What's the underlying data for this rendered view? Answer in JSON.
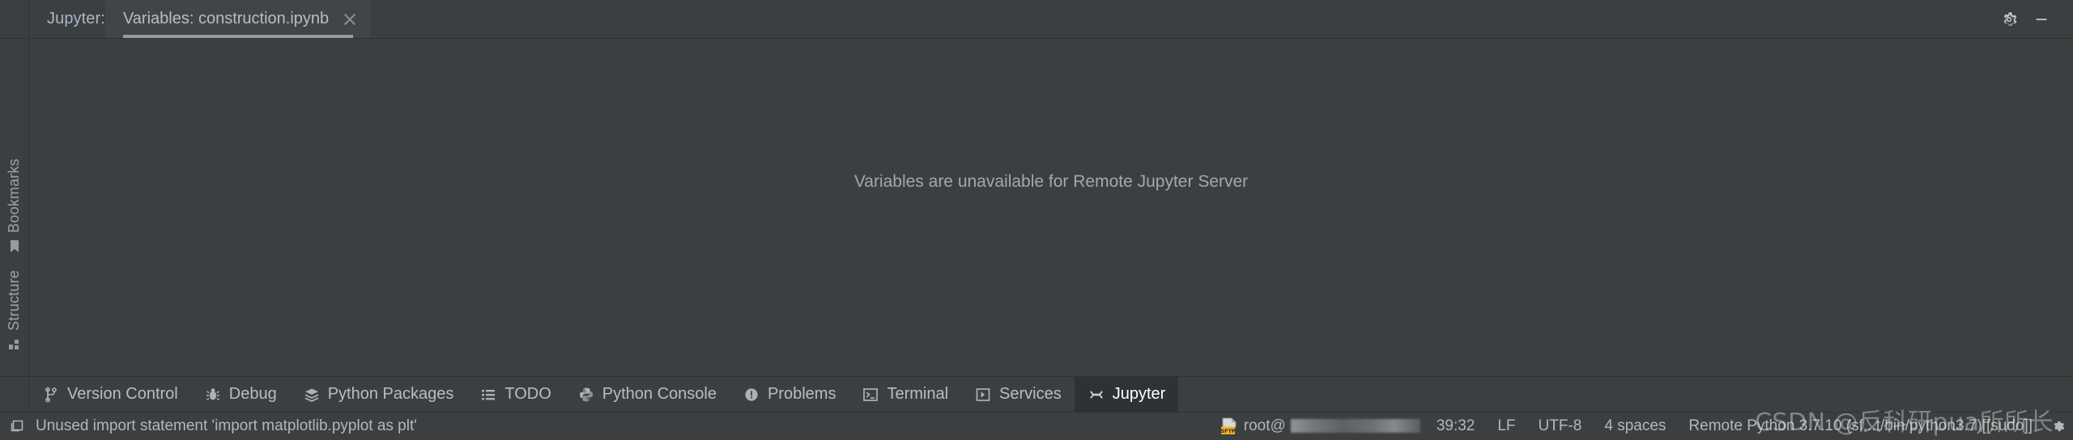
{
  "window": {
    "tool_window_label": "Jupyter:",
    "buttons": [
      {
        "name": "settings-button",
        "icon": "gear-icon"
      },
      {
        "name": "minimize-button",
        "icon": "minimize-icon"
      }
    ]
  },
  "tabs": [
    {
      "label": "Variables: construction.ipynb",
      "active": true,
      "closable": true
    }
  ],
  "left_rail": {
    "items": [
      {
        "label": "Bookmarks",
        "icon": "bookmark-icon"
      },
      {
        "label": "Structure",
        "icon": "structure-icon"
      }
    ]
  },
  "main": {
    "message": "Variables are unavailable for Remote Jupyter Server"
  },
  "bottom_tools": [
    {
      "label": "Version Control",
      "icon": "branch-icon",
      "active": false
    },
    {
      "label": "Debug",
      "icon": "bug-icon",
      "active": false
    },
    {
      "label": "Python Packages",
      "icon": "packages-icon",
      "active": false
    },
    {
      "label": "TODO",
      "icon": "list-icon",
      "active": false
    },
    {
      "label": "Python Console",
      "icon": "python-icon",
      "active": false
    },
    {
      "label": "Problems",
      "icon": "warning-icon",
      "active": false
    },
    {
      "label": "Terminal",
      "icon": "terminal-icon",
      "active": false
    },
    {
      "label": "Services",
      "icon": "services-icon",
      "active": false
    },
    {
      "label": "Jupyter",
      "icon": "jupyter-icon",
      "active": true
    }
  ],
  "status_bar": {
    "inspection_icon": "inspection-icon",
    "message": "Unused import statement 'import matplotlib.pyplot as plt'",
    "sftp_icon": "sftp-icon",
    "remote_user": "root@",
    "remote_host_redacted": true,
    "caret_position": "39:32",
    "line_separator": "LF",
    "encoding": "UTF-8",
    "indent": "4 spaces",
    "interpreter": "Remote Python 3.7.10 (sf...t/bin/python3.7)[[sudo]]",
    "settings_icon": "gear-icon"
  },
  "watermark": "CSDN @反科研pua所所长",
  "colors": {
    "background": "#3c3f41",
    "tab_active": "#41454a",
    "bottom_active": "#2f3234",
    "text": "#bcbcbc",
    "muted_text": "#a6a6a6",
    "border": "#323232"
  }
}
